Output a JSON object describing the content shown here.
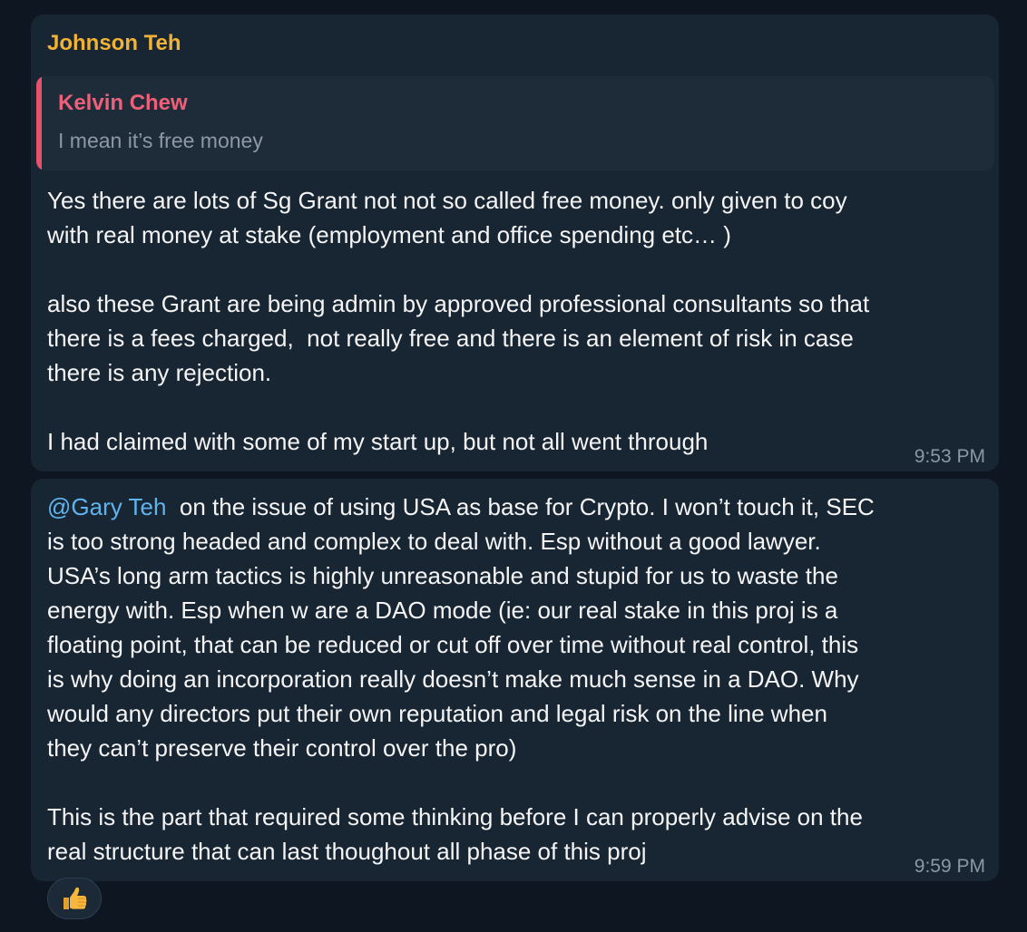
{
  "message1": {
    "sender": "Johnson Teh",
    "reply": {
      "name": "Kelvin Chew",
      "text": "I mean it’s free money"
    },
    "text": "Yes there are lots of Sg Grant not not so called free money. only given to coy\nwith real money at stake (employment and office spending etc… )\n\nalso these Grant are being admin by approved professional consultants so that\nthere is a fees charged,  not really free and there is an element of risk in case\nthere is any rejection.\n\nI had claimed with some of my start up, but not all went through",
    "time": "9:53 PM"
  },
  "message2": {
    "mention": "@Gary Teh",
    "text": "  on the issue of using USA as base for Crypto. I won’t touch it, SEC\nis too strong headed and complex to deal with. Esp without a good lawyer.\nUSA’s long arm tactics is highly unreasonable and stupid for us to waste the\nenergy with. Esp when w are a DAO mode (ie: our real stake in this proj is a\nfloating point, that can be reduced or cut off over time without real control, this\nis why doing an incorporation really doesn’t make much sense in a DAO. Why\nwould any directors put their own reputation and legal risk on the line when\nthey can’t preserve their control over the pro)\n\nThis is the part that required some thinking before I can properly advise on the\nreal structure that can last thoughout all phase of this proj",
    "time": "9:59 PM"
  },
  "reaction": {
    "icon": "thumbs-up-icon",
    "color": "#f6b73c"
  },
  "colors": {
    "background": "#0e1621",
    "bubble": "#182533",
    "sender": "#f2b233",
    "reply_name": "#ee6079",
    "mention": "#5fb4f0"
  }
}
